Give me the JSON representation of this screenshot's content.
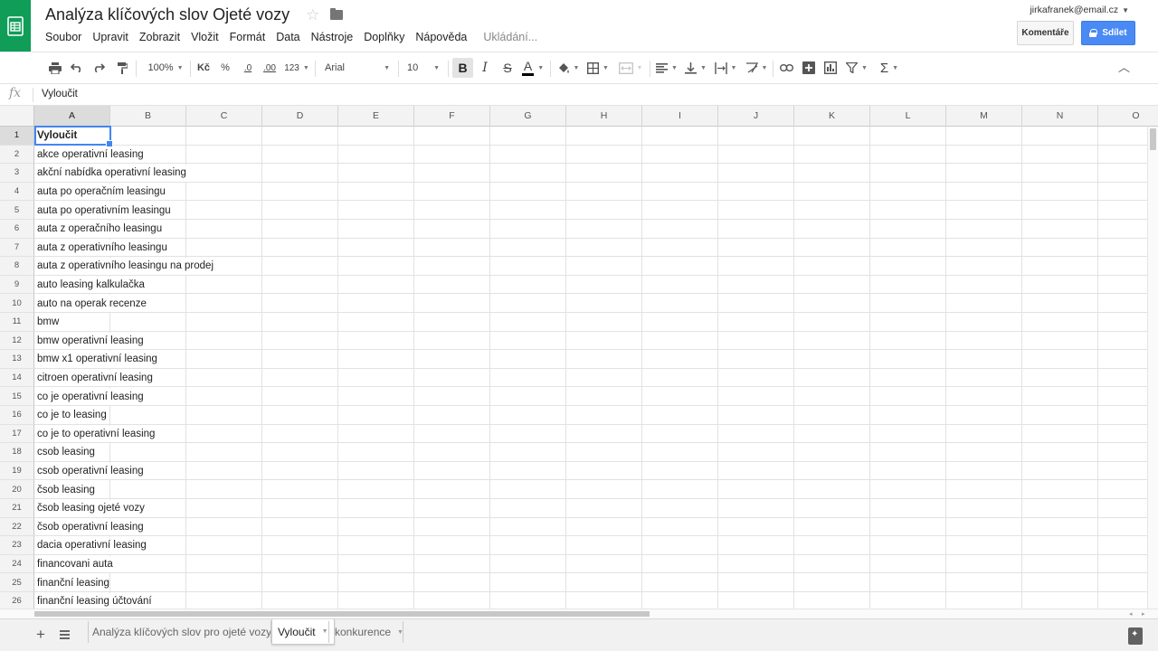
{
  "app": {
    "title": "Analýza klíčových slov Ojeté vozy",
    "account": "jirkafranek@email.cz",
    "comments_label": "Komentáře",
    "share_label": "Sdílet",
    "saving_status": "Ukládání..."
  },
  "menu": [
    "Soubor",
    "Upravit",
    "Zobrazit",
    "Vložit",
    "Formát",
    "Data",
    "Nástroje",
    "Doplňky",
    "Nápověda"
  ],
  "toolbar": {
    "zoom": "100%",
    "currency": "Kč",
    "percent": "%",
    "decimal_decrease": ".0",
    "decimal_increase": ".00",
    "number_format": "123",
    "font": "Arial",
    "font_size": "10",
    "bold": "B",
    "italic": "I",
    "strikethrough": "S",
    "text_color": "A",
    "sum": "Σ"
  },
  "formula_bar": {
    "fx": "fx",
    "value": "Vyloučit"
  },
  "columns": [
    "A",
    "B",
    "C",
    "D",
    "E",
    "F",
    "G",
    "H",
    "I",
    "J",
    "K",
    "L",
    "M",
    "N",
    "O"
  ],
  "rows": [
    {
      "n": "1",
      "a": "Vyloučit"
    },
    {
      "n": "2",
      "a": "akce operativní leasing"
    },
    {
      "n": "3",
      "a": "akční nabídka operativní leasing"
    },
    {
      "n": "4",
      "a": "auta po operačním leasingu"
    },
    {
      "n": "5",
      "a": "auta po operativním leasingu"
    },
    {
      "n": "6",
      "a": "auta z operačního leasingu"
    },
    {
      "n": "7",
      "a": "auta z operativního leasingu"
    },
    {
      "n": "8",
      "a": "auta z operativního leasingu na prodej"
    },
    {
      "n": "9",
      "a": "auto leasing kalkulačka"
    },
    {
      "n": "10",
      "a": "auto na operak recenze"
    },
    {
      "n": "11",
      "a": "bmw"
    },
    {
      "n": "12",
      "a": "bmw operativní leasing"
    },
    {
      "n": "13",
      "a": "bmw x1 operativní leasing"
    },
    {
      "n": "14",
      "a": "citroen operativní leasing"
    },
    {
      "n": "15",
      "a": "co je operativní leasing"
    },
    {
      "n": "16",
      "a": "co je to leasing"
    },
    {
      "n": "17",
      "a": "co je to operativní leasing"
    },
    {
      "n": "18",
      "a": "csob leasing"
    },
    {
      "n": "19",
      "a": "csob operativní leasing"
    },
    {
      "n": "20",
      "a": "čsob leasing"
    },
    {
      "n": "21",
      "a": "čsob leasing ojeté vozy"
    },
    {
      "n": "22",
      "a": "čsob operativní leasing"
    },
    {
      "n": "23",
      "a": "dacia operativní leasing"
    },
    {
      "n": "24",
      "a": "financovani auta"
    },
    {
      "n": "25",
      "a": "finanční leasing"
    },
    {
      "n": "26",
      "a": "finanční leasing účtování"
    }
  ],
  "sheets": [
    {
      "label": "Analýza klíčových slov pro ojeté vozy",
      "active": false
    },
    {
      "label": "Vyloučit",
      "active": true
    },
    {
      "label": "konkurence",
      "active": false
    }
  ],
  "colors": {
    "brand_green": "#0f9d58",
    "share_blue": "#4a8af4",
    "selection_blue": "#4285f4"
  }
}
